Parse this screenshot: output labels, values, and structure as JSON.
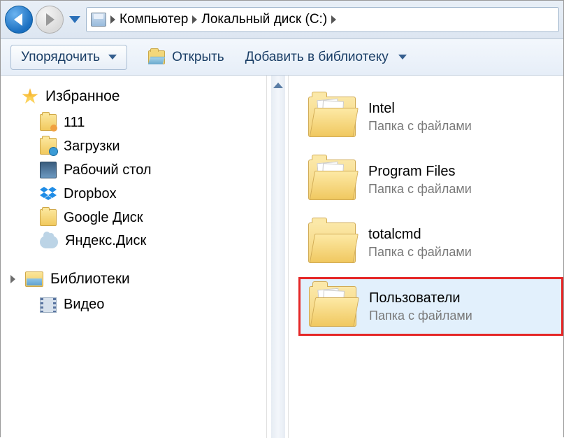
{
  "breadcrumb": {
    "items": [
      "Компьютер",
      "Локальный диск (C:)"
    ]
  },
  "toolbar": {
    "organize": "Упорядочить",
    "open": "Открыть",
    "add_library": "Добавить в библиотеку"
  },
  "sidebar": {
    "favorites": {
      "header": "Избранное",
      "items": [
        {
          "label": "111"
        },
        {
          "label": "Загрузки"
        },
        {
          "label": "Рабочий стол"
        },
        {
          "label": "Dropbox"
        },
        {
          "label": "Google Диск"
        },
        {
          "label": "Яндекс.Диск"
        }
      ]
    },
    "libraries": {
      "header": "Библиотеки",
      "items": [
        {
          "label": "Видео"
        }
      ]
    }
  },
  "content": {
    "subtype": "Папка с файлами",
    "items": [
      {
        "name": "Intel",
        "selected": false,
        "highlighted": false
      },
      {
        "name": "Program Files",
        "selected": false,
        "highlighted": false
      },
      {
        "name": "totalcmd",
        "selected": false,
        "highlighted": false,
        "empty": true
      },
      {
        "name": "Пользователи",
        "selected": true,
        "highlighted": true
      }
    ]
  }
}
